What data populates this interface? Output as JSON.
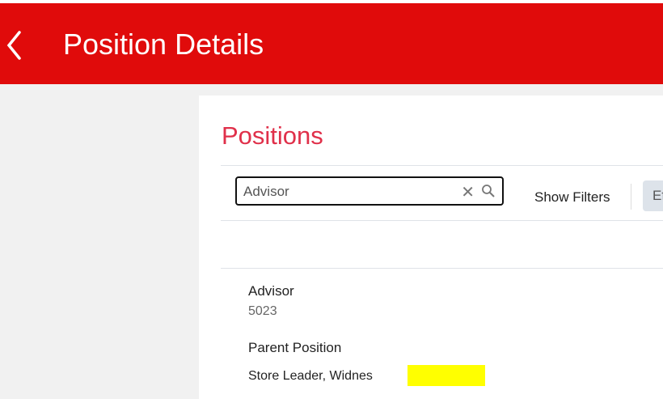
{
  "header": {
    "title": "Position Details",
    "back_icon": "chevron-left-icon"
  },
  "panel": {
    "title": "Positions",
    "search": {
      "value": "Advisor",
      "placeholder": ""
    },
    "show_filters": "Show Filters",
    "button_label": "Ef"
  },
  "result": {
    "name": "Advisor",
    "code": "5023",
    "parent_label": "Parent Position",
    "parent_value": "Store Leader, Widnes"
  },
  "colors": {
    "header": "#e00b0b",
    "title": "#e0304a",
    "highlight": "#ffff00"
  }
}
